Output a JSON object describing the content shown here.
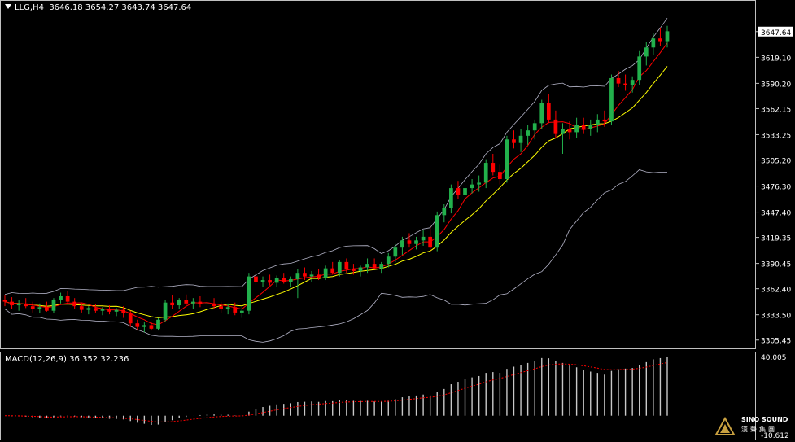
{
  "header": {
    "symbol_tf": "LLG,H4",
    "ohlc": "3646.18 3654.27 3643.74 3647.64"
  },
  "macd": {
    "label": "MACD(12,26,9)",
    "values": "36.352 32.236",
    "axis_top": "40.005",
    "axis_bottom": "-10.612"
  },
  "logo": {
    "name": "SINO SOUND",
    "cn": "漢聲集團"
  },
  "colors": {
    "background": "#000000",
    "bull": "#22b14c",
    "bear": "#ff0000",
    "ma_fast": "#ff0000",
    "ma_slow": "#ffff00",
    "bands": "#b4b4c8",
    "macd_hist": "#c8c8c8",
    "macd_signal": "#ff0000",
    "price_tag_bg": "#ffffff"
  },
  "chart_data": {
    "type": "candlestick",
    "title": "LLG,H4",
    "y_ticks": [
      "3647.64",
      "3619.10",
      "3590.20",
      "3562.15",
      "3533.25",
      "3505.20",
      "3476.30",
      "3447.40",
      "3419.35",
      "3390.45",
      "3362.40",
      "3333.50",
      "3305.45"
    ],
    "ylim": [
      3298,
      3670
    ],
    "current_price": "3647.64",
    "candles_ohlc": [
      [
        3350,
        3355,
        3343,
        3348
      ],
      [
        3348,
        3353,
        3340,
        3344
      ],
      [
        3344,
        3350,
        3338,
        3346
      ],
      [
        3346,
        3352,
        3341,
        3343
      ],
      [
        3343,
        3348,
        3336,
        3340
      ],
      [
        3340,
        3346,
        3335,
        3342
      ],
      [
        3342,
        3348,
        3337,
        3338
      ],
      [
        3338,
        3352,
        3335,
        3350
      ],
      [
        3350,
        3358,
        3346,
        3354
      ],
      [
        3354,
        3360,
        3345,
        3348
      ],
      [
        3348,
        3352,
        3340,
        3343
      ],
      [
        3343,
        3347,
        3336,
        3339
      ],
      [
        3339,
        3343,
        3334,
        3341
      ],
      [
        3341,
        3345,
        3336,
        3338
      ],
      [
        3338,
        3342,
        3333,
        3340
      ],
      [
        3340,
        3344,
        3334,
        3337
      ],
      [
        3337,
        3341,
        3332,
        3339
      ],
      [
        3339,
        3343,
        3330,
        3335
      ],
      [
        3335,
        3338,
        3320,
        3324
      ],
      [
        3324,
        3328,
        3316,
        3320
      ],
      [
        3320,
        3325,
        3314,
        3322
      ],
      [
        3322,
        3326,
        3316,
        3318
      ],
      [
        3318,
        3330,
        3316,
        3328
      ],
      [
        3328,
        3350,
        3326,
        3347
      ],
      [
        3347,
        3355,
        3340,
        3344
      ],
      [
        3344,
        3352,
        3340,
        3350
      ],
      [
        3350,
        3356,
        3344,
        3346
      ],
      [
        3346,
        3352,
        3340,
        3348
      ],
      [
        3348,
        3354,
        3342,
        3345
      ],
      [
        3345,
        3350,
        3338,
        3346
      ],
      [
        3346,
        3352,
        3340,
        3343
      ],
      [
        3343,
        3348,
        3336,
        3340
      ],
      [
        3340,
        3346,
        3334,
        3342
      ],
      [
        3342,
        3347,
        3333,
        3336
      ],
      [
        3336,
        3342,
        3330,
        3338
      ],
      [
        3338,
        3380,
        3334,
        3376
      ],
      [
        3376,
        3382,
        3366,
        3370
      ],
      [
        3370,
        3376,
        3364,
        3372
      ],
      [
        3372,
        3378,
        3366,
        3369
      ],
      [
        3369,
        3377,
        3364,
        3374
      ],
      [
        3374,
        3380,
        3368,
        3370
      ],
      [
        3370,
        3376,
        3364,
        3373
      ],
      [
        3373,
        3384,
        3352,
        3380
      ],
      [
        3380,
        3386,
        3372,
        3376
      ],
      [
        3376,
        3382,
        3370,
        3378
      ],
      [
        3378,
        3384,
        3372,
        3374
      ],
      [
        3374,
        3388,
        3372,
        3385
      ],
      [
        3385,
        3392,
        3378,
        3380
      ],
      [
        3380,
        3394,
        3376,
        3392
      ],
      [
        3392,
        3396,
        3380,
        3384
      ],
      [
        3384,
        3390,
        3378,
        3382
      ],
      [
        3382,
        3388,
        3376,
        3386
      ],
      [
        3386,
        3396,
        3380,
        3390
      ],
      [
        3390,
        3396,
        3384,
        3385
      ],
      [
        3385,
        3392,
        3380,
        3390
      ],
      [
        3390,
        3402,
        3386,
        3398
      ],
      [
        3398,
        3412,
        3392,
        3408
      ],
      [
        3408,
        3420,
        3400,
        3416
      ],
      [
        3416,
        3424,
        3408,
        3412
      ],
      [
        3412,
        3420,
        3406,
        3416
      ],
      [
        3416,
        3428,
        3410,
        3420
      ],
      [
        3420,
        3432,
        3404,
        3408
      ],
      [
        3408,
        3448,
        3404,
        3444
      ],
      [
        3444,
        3456,
        3436,
        3452
      ],
      [
        3452,
        3478,
        3446,
        3474
      ],
      [
        3474,
        3482,
        3462,
        3466
      ],
      [
        3466,
        3478,
        3458,
        3474
      ],
      [
        3474,
        3484,
        3468,
        3478
      ],
      [
        3478,
        3488,
        3470,
        3480
      ],
      [
        3480,
        3506,
        3474,
        3502
      ],
      [
        3502,
        3512,
        3488,
        3492
      ],
      [
        3492,
        3500,
        3478,
        3484
      ],
      [
        3484,
        3532,
        3480,
        3528
      ],
      [
        3528,
        3538,
        3518,
        3524
      ],
      [
        3524,
        3540,
        3514,
        3532
      ],
      [
        3532,
        3544,
        3522,
        3538
      ],
      [
        3538,
        3550,
        3528,
        3546
      ],
      [
        3546,
        3572,
        3540,
        3568
      ],
      [
        3568,
        3578,
        3546,
        3550
      ],
      [
        3550,
        3560,
        3530,
        3534
      ],
      [
        3534,
        3546,
        3512,
        3540
      ],
      [
        3540,
        3548,
        3528,
        3536
      ],
      [
        3536,
        3552,
        3530,
        3544
      ],
      [
        3544,
        3552,
        3534,
        3540
      ],
      [
        3540,
        3550,
        3532,
        3544
      ],
      [
        3544,
        3556,
        3536,
        3550
      ],
      [
        3550,
        3560,
        3542,
        3548
      ],
      [
        3548,
        3600,
        3544,
        3596
      ],
      [
        3596,
        3604,
        3586,
        3590
      ],
      [
        3590,
        3600,
        3582,
        3588
      ],
      [
        3588,
        3598,
        3580,
        3594
      ],
      [
        3594,
        3626,
        3588,
        3620
      ],
      [
        3620,
        3636,
        3610,
        3630
      ],
      [
        3630,
        3646,
        3622,
        3640
      ],
      [
        3640,
        3652,
        3632,
        3637
      ],
      [
        3637,
        3654,
        3630,
        3648
      ]
    ],
    "series": [
      {
        "name": "",
        "color": "#ff0000",
        "type": "ma"
      },
      {
        "name": "",
        "color": "#ffff00",
        "type": "ma"
      },
      {
        "name": "",
        "color": "#b4b4c8",
        "type": "band"
      }
    ]
  }
}
